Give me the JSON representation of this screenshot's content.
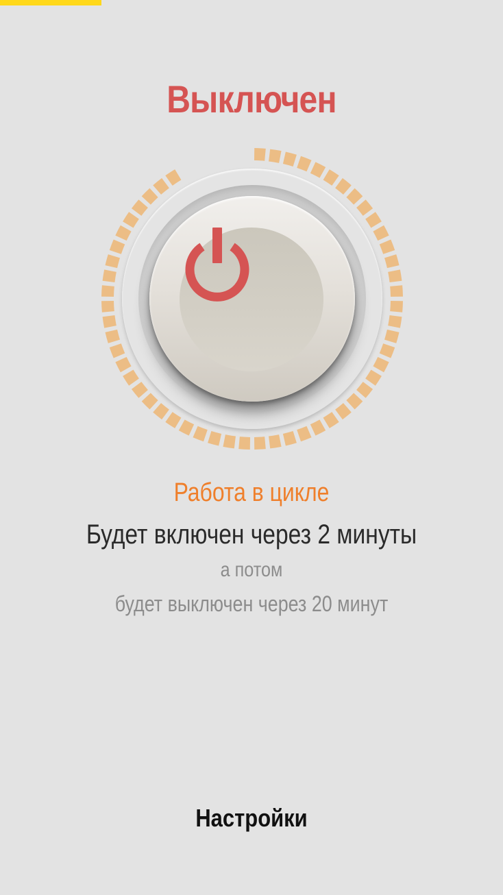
{
  "status": {
    "title": "Выключен",
    "title_color": "#d55453"
  },
  "dial": {
    "progress_fraction": 0.92,
    "segment_color": "#ecbd85",
    "power_icon": "power-icon",
    "power_icon_color": "#d55453"
  },
  "schedule": {
    "mode": "Работа в цикле",
    "mode_color": "#ef7f2b",
    "next": "Будет включен через 2 минуты",
    "then": "а потом",
    "after": "будет выключен через 20 минут"
  },
  "footer": {
    "settings_label": "Настройки"
  },
  "theme": {
    "background": "#e3e3e3",
    "top_accent": "#ffd81a"
  }
}
